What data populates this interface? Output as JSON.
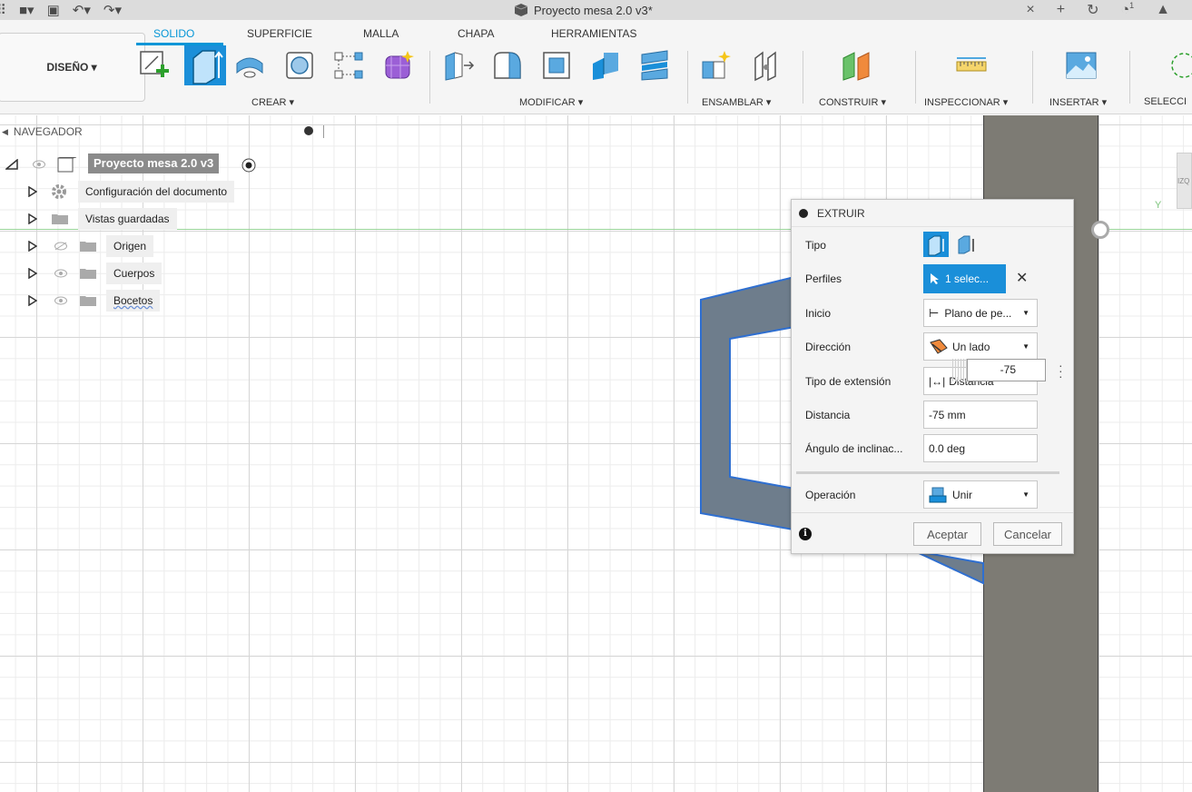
{
  "titlebar": {
    "document_title": "Proyecto mesa 2.0 v3*",
    "notification_count": "1",
    "icons": [
      "grid-icon",
      "file-icon",
      "save-icon",
      "undo-icon",
      "redo-icon",
      "close-icon",
      "plus-icon",
      "refresh-icon",
      "clock-icon",
      "bell-icon"
    ]
  },
  "ribbon": {
    "workspace_label": "DISEÑO ▾",
    "tabs": [
      {
        "label": "SOLIDO",
        "active": true
      },
      {
        "label": "SUPERFICIE",
        "active": false
      },
      {
        "label": "MALLA",
        "active": false
      },
      {
        "label": "CHAPA",
        "active": false
      },
      {
        "label": "HERRAMIENTAS",
        "active": false
      }
    ],
    "groups": {
      "crear": "CREAR ▾",
      "modificar": "MODIFICAR ▾",
      "ensamblar": "ENSAMBLAR ▾",
      "construir": "CONSTRUIR ▾",
      "inspeccionar": "INSPECCIONAR ▾",
      "insertar": "INSERTAR ▾",
      "seleccionar": "SELECCI"
    },
    "accent_color": "#0696d7"
  },
  "navigator": {
    "title": "NAVEGADOR",
    "root": "Proyecto mesa 2.0 v3",
    "items": [
      {
        "label": "Configuración del documento",
        "icon": "gear-icon"
      },
      {
        "label": "Vistas guardadas",
        "icon": "folder-icon"
      },
      {
        "label": "Origen",
        "icon": "folder-icon",
        "visibility": "hidden"
      },
      {
        "label": "Cuerpos",
        "icon": "folder-icon",
        "visibility": "visible"
      },
      {
        "label": "Bocetos",
        "icon": "folder-icon",
        "visibility": "visible"
      }
    ]
  },
  "extrude": {
    "title": "EXTRUIR",
    "labels": {
      "tipo": "Tipo",
      "perfiles": "Perfiles",
      "inicio": "Inicio",
      "direccion": "Dirección",
      "tipo_extension": "Tipo de extensión",
      "distancia": "Distancia",
      "angulo": "Ángulo de inclinac...",
      "operacion": "Operación"
    },
    "values": {
      "perfiles": "1 selec...",
      "inicio": "Plano de pe...",
      "direccion": "Un lado",
      "tipo_extension": "Distancia",
      "distancia": "-75 mm",
      "angulo": "0.0 deg",
      "operacion": "Unir"
    },
    "distance_input": "-75",
    "buttons": {
      "ok": "Aceptar",
      "cancel": "Cancelar"
    }
  },
  "viewcube": {
    "axis_label": "Y",
    "face_label": "IZQ"
  }
}
